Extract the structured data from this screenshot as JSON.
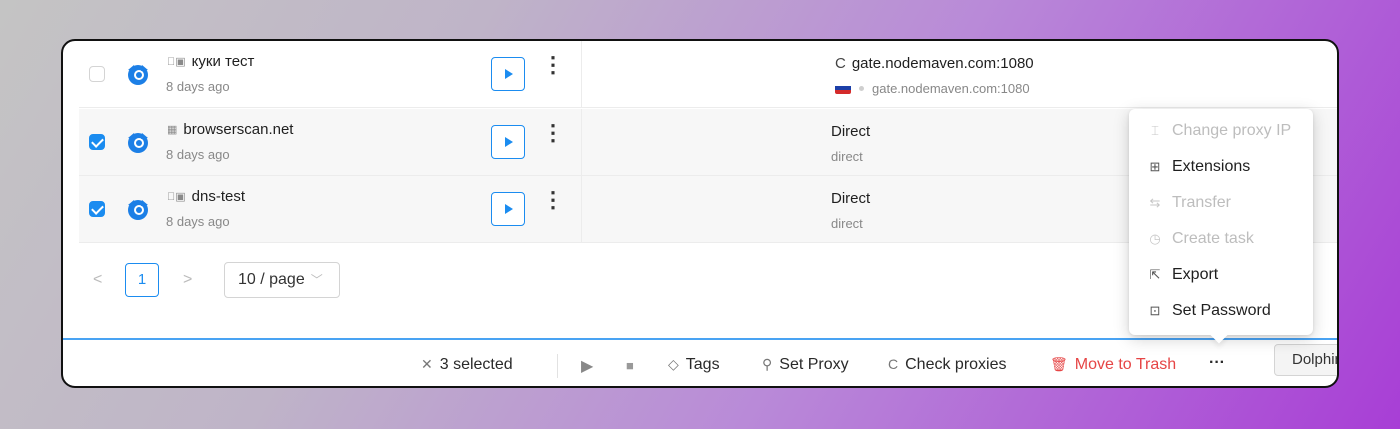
{
  "rows": [
    {
      "name": "куки тест",
      "time": "8 days ago",
      "checked": false,
      "os": "apple",
      "proxy_main": "gate.nodemaven.com:1080",
      "proxy_sub": "gate.nodemaven.com:1080"
    },
    {
      "name": "browserscan.net",
      "time": "8 days ago",
      "checked": true,
      "os": "windows",
      "proxy_main": "Direct",
      "proxy_sub": "direct"
    },
    {
      "name": "dns-test",
      "time": "8 days ago",
      "checked": true,
      "os": "apple",
      "proxy_main": "Direct",
      "proxy_sub": "direct"
    }
  ],
  "pagination": {
    "prev": "<",
    "page": "1",
    "next": ">",
    "page_size": "10 / page"
  },
  "toolbar": {
    "selected": "3 selected",
    "tags": "Tags",
    "set_proxy": "Set Proxy",
    "check_proxies": "Check proxies",
    "move_to_trash": "Move to Trash",
    "more": "···",
    "dolphin": "Dolphin"
  },
  "menu": {
    "change_proxy_ip": "Change proxy IP",
    "extensions": "Extensions",
    "transfer": "Transfer",
    "create_task": "Create task",
    "export": "Export",
    "set_password": "Set Password"
  },
  "colors": {
    "accent": "#1b8cf0",
    "danger": "#e64545"
  }
}
